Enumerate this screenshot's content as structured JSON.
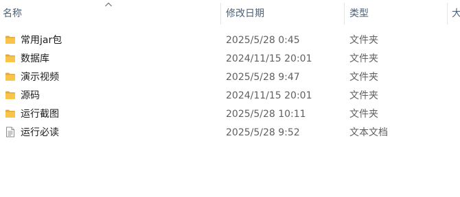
{
  "columns": {
    "name": "名称",
    "date": "修改日期",
    "type": "类型",
    "size": "大"
  },
  "files": [
    {
      "name": "常用jar包",
      "date": "2025/5/28 0:45",
      "type": "文件夹",
      "icon": "folder-icon"
    },
    {
      "name": "数据库",
      "date": "2024/11/15 20:01",
      "type": "文件夹",
      "icon": "folder-icon"
    },
    {
      "name": "演示视频",
      "date": "2025/5/28 9:47",
      "type": "文件夹",
      "icon": "folder-icon"
    },
    {
      "name": "源码",
      "date": "2024/11/15 20:01",
      "type": "文件夹",
      "icon": "folder-icon"
    },
    {
      "name": "运行截图",
      "date": "2025/5/28 10:11",
      "type": "文件夹",
      "icon": "folder-icon"
    },
    {
      "name": "运行必读",
      "date": "2025/5/28 9:52",
      "type": "文本文档",
      "icon": "text-document-icon"
    }
  ],
  "colors": {
    "header_text": "#4c607a",
    "folder": "#f8c54a",
    "folder_dark": "#e3a93a"
  }
}
